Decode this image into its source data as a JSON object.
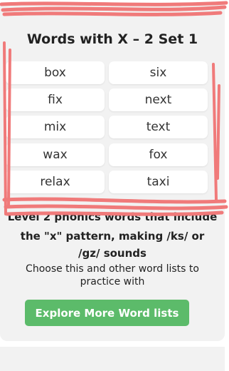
{
  "title": "Words with X – 2 Set 1",
  "words": [
    "box",
    "six",
    "fix",
    "next",
    "mix",
    "text",
    "wax",
    "fox",
    "relax",
    "taxi"
  ],
  "description": {
    "line1": "Level 2 phonics words that include",
    "line2": "the \"x\" pattern, making /ks/ or",
    "line3": "/gz/ sounds"
  },
  "subtext": "Choose this and other word lists to practice with",
  "button_label": "Explore More Word lists",
  "colors": {
    "accent": "#5cbb6a",
    "scribble": "#f07a7a"
  }
}
